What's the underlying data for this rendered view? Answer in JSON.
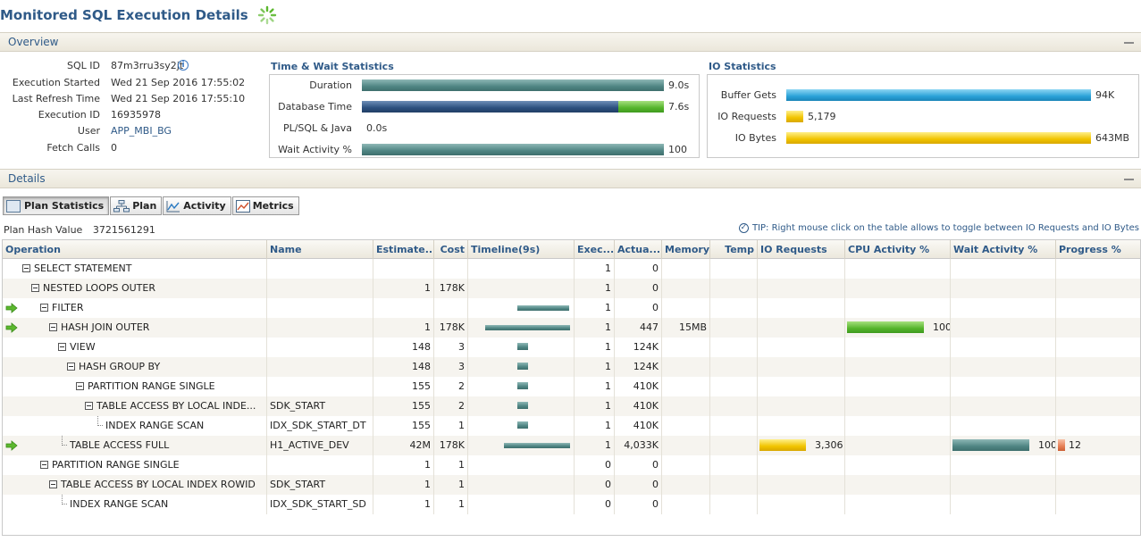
{
  "page_title": "Monitored SQL Execution Details",
  "overview": {
    "header": "Overview",
    "fields": [
      {
        "label": "SQL ID",
        "value": "87m3rru3sy2jt"
      },
      {
        "label": "Execution Started",
        "value": "Wed 21 Sep 2016 17:55:02"
      },
      {
        "label": "Last Refresh Time",
        "value": "Wed 21 Sep 2016 17:55:10"
      },
      {
        "label": "Execution ID",
        "value": "16935978"
      },
      {
        "label": "User",
        "value": "APP_MBI_BG"
      },
      {
        "label": "Fetch Calls",
        "value": "0"
      }
    ],
    "time_wait": {
      "title": "Time & Wait Statistics",
      "rows": [
        {
          "label": "Duration",
          "value": "9.0s",
          "fraction": 1.0
        },
        {
          "label": "Database Time",
          "value": "7.6s",
          "fraction": 0.85,
          "green_fraction": 0.15
        },
        {
          "label": "PL/SQL & Java",
          "value": "0.0s",
          "fraction": 0
        },
        {
          "label": "Wait Activity %",
          "value": "100",
          "fraction": 1.0
        }
      ]
    },
    "io": {
      "title": "IO Statistics",
      "rows": [
        {
          "label": "Buffer Gets",
          "value": "94K",
          "fraction": 1.0
        },
        {
          "label": "IO Requests",
          "value": "5,179",
          "fraction": 0.055
        },
        {
          "label": "IO Bytes",
          "value": "643MB",
          "fraction": 1.0
        }
      ]
    }
  },
  "details": {
    "header": "Details",
    "tabs": [
      "Plan Statistics",
      "Plan",
      "Activity",
      "Metrics"
    ],
    "plan_hash_label": "Plan Hash Value",
    "plan_hash_value": "3721561291",
    "tip": "TIP: Right mouse click on the table allows to toggle between IO Requests and IO Bytes",
    "columns": [
      "Operation",
      "Name",
      "Estimate...",
      "Cost",
      "Timeline(9s)",
      "Exec...",
      "Actua...",
      "Memory",
      "Temp",
      "IO Requests",
      "CPU Activity %",
      "Wait Activity %",
      "Progress %"
    ],
    "rows": [
      {
        "op": "SELECT STATEMENT",
        "depth": 0,
        "toggle": true,
        "arrow": false,
        "name": "",
        "est": "",
        "cost": "",
        "tl": null,
        "exec": "1",
        "actual": "0",
        "memory": "",
        "temp": "",
        "io": "",
        "io_f": 0,
        "cpu": "",
        "cpu_f": 0,
        "wait": "",
        "wait_f": 0,
        "prog": "",
        "prog_f": 0
      },
      {
        "op": "NESTED LOOPS OUTER",
        "depth": 1,
        "toggle": true,
        "arrow": false,
        "name": "",
        "est": "1",
        "cost": "178K",
        "tl": null,
        "exec": "1",
        "actual": "0",
        "memory": "",
        "temp": "",
        "io": "",
        "io_f": 0,
        "cpu": "",
        "cpu_f": 0,
        "wait": "",
        "wait_f": 0,
        "prog": "",
        "prog_f": 0
      },
      {
        "op": "FILTER",
        "depth": 2,
        "toggle": true,
        "arrow": true,
        "name": "",
        "est": "",
        "cost": "",
        "tl": [
          0.45,
          1.0
        ],
        "exec": "1",
        "actual": "0",
        "memory": "",
        "temp": "",
        "io": "",
        "io_f": 0,
        "cpu": "",
        "cpu_f": 0,
        "wait": "",
        "wait_f": 0,
        "prog": "",
        "prog_f": 0
      },
      {
        "op": "HASH JOIN OUTER",
        "depth": 3,
        "toggle": true,
        "arrow": true,
        "name": "",
        "est": "1",
        "cost": "178K",
        "tl": [
          0.1,
          1.0
        ],
        "exec": "1",
        "actual": "447",
        "memory": "15MB",
        "temp": "",
        "io": "",
        "io_f": 0,
        "cpu": "100",
        "cpu_f": 1.0,
        "wait": "",
        "wait_f": 0,
        "prog": "",
        "prog_f": 0
      },
      {
        "op": "VIEW",
        "depth": 4,
        "toggle": true,
        "arrow": false,
        "name": "",
        "est": "148",
        "cost": "3",
        "tl": [
          0.45,
          0.55
        ],
        "exec": "1",
        "actual": "124K",
        "memory": "",
        "temp": "",
        "io": "",
        "io_f": 0,
        "cpu": "",
        "cpu_f": 0,
        "wait": "",
        "wait_f": 0,
        "prog": "",
        "prog_f": 0
      },
      {
        "op": "HASH GROUP BY",
        "depth": 5,
        "toggle": true,
        "arrow": false,
        "name": "",
        "est": "148",
        "cost": "3",
        "tl": [
          0.45,
          0.55
        ],
        "exec": "1",
        "actual": "124K",
        "memory": "",
        "temp": "",
        "io": "",
        "io_f": 0,
        "cpu": "",
        "cpu_f": 0,
        "wait": "",
        "wait_f": 0,
        "prog": "",
        "prog_f": 0
      },
      {
        "op": "PARTITION RANGE SINGLE",
        "depth": 6,
        "toggle": true,
        "arrow": false,
        "name": "",
        "est": "155",
        "cost": "2",
        "tl": [
          0.45,
          0.55
        ],
        "exec": "1",
        "actual": "410K",
        "memory": "",
        "temp": "",
        "io": "",
        "io_f": 0,
        "cpu": "",
        "cpu_f": 0,
        "wait": "",
        "wait_f": 0,
        "prog": "",
        "prog_f": 0
      },
      {
        "op": "TABLE ACCESS BY LOCAL INDE...",
        "depth": 7,
        "toggle": true,
        "arrow": false,
        "name": "SDK_START",
        "est": "155",
        "cost": "2",
        "tl": [
          0.45,
          0.55
        ],
        "exec": "1",
        "actual": "410K",
        "memory": "",
        "temp": "",
        "io": "",
        "io_f": 0,
        "cpu": "",
        "cpu_f": 0,
        "wait": "",
        "wait_f": 0,
        "prog": "",
        "prog_f": 0
      },
      {
        "op": "INDEX RANGE SCAN",
        "depth": 8,
        "toggle": false,
        "arrow": false,
        "name": "IDX_SDK_START_DT",
        "est": "155",
        "cost": "1",
        "tl": [
          0.45,
          0.55
        ],
        "exec": "1",
        "actual": "410K",
        "memory": "",
        "temp": "",
        "io": "",
        "io_f": 0,
        "cpu": "",
        "cpu_f": 0,
        "wait": "",
        "wait_f": 0,
        "prog": "",
        "prog_f": 0
      },
      {
        "op": "TABLE ACCESS FULL",
        "depth": 4,
        "toggle": false,
        "arrow": true,
        "name": "H1_ACTIVE_DEV",
        "est": "42M",
        "cost": "178K",
        "tl": [
          0.3,
          1.0
        ],
        "exec": "1",
        "actual": "4,033K",
        "memory": "",
        "temp": "",
        "io": "3,306",
        "io_f": 1.0,
        "cpu": "",
        "cpu_f": 0,
        "wait": "100",
        "wait_f": 1.0,
        "prog": "12",
        "prog_f": 0.12
      },
      {
        "op": "PARTITION RANGE SINGLE",
        "depth": 2,
        "toggle": true,
        "arrow": false,
        "name": "",
        "est": "1",
        "cost": "1",
        "tl": null,
        "exec": "0",
        "actual": "0",
        "memory": "",
        "temp": "",
        "io": "",
        "io_f": 0,
        "cpu": "",
        "cpu_f": 0,
        "wait": "",
        "wait_f": 0,
        "prog": "",
        "prog_f": 0
      },
      {
        "op": "TABLE ACCESS BY LOCAL INDEX ROWID",
        "depth": 3,
        "toggle": true,
        "arrow": false,
        "name": "SDK_START",
        "est": "1",
        "cost": "1",
        "tl": null,
        "exec": "0",
        "actual": "0",
        "memory": "",
        "temp": "",
        "io": "",
        "io_f": 0,
        "cpu": "",
        "cpu_f": 0,
        "wait": "",
        "wait_f": 0,
        "prog": "",
        "prog_f": 0
      },
      {
        "op": "INDEX RANGE SCAN",
        "depth": 4,
        "toggle": false,
        "arrow": false,
        "name": "IDX_SDK_START_SD",
        "est": "1",
        "cost": "1",
        "tl": null,
        "exec": "0",
        "actual": "0",
        "memory": "",
        "temp": "",
        "io": "",
        "io_f": 0,
        "cpu": "",
        "cpu_f": 0,
        "wait": "",
        "wait_f": 0,
        "prog": "",
        "prog_f": 0
      }
    ]
  },
  "colors": {
    "accent": "#2f5a88",
    "teal": "#4f8583",
    "green": "#55b52c",
    "blue": "#2aa2d8",
    "yellow": "#f1c400",
    "arrow": "#5cb82e"
  }
}
